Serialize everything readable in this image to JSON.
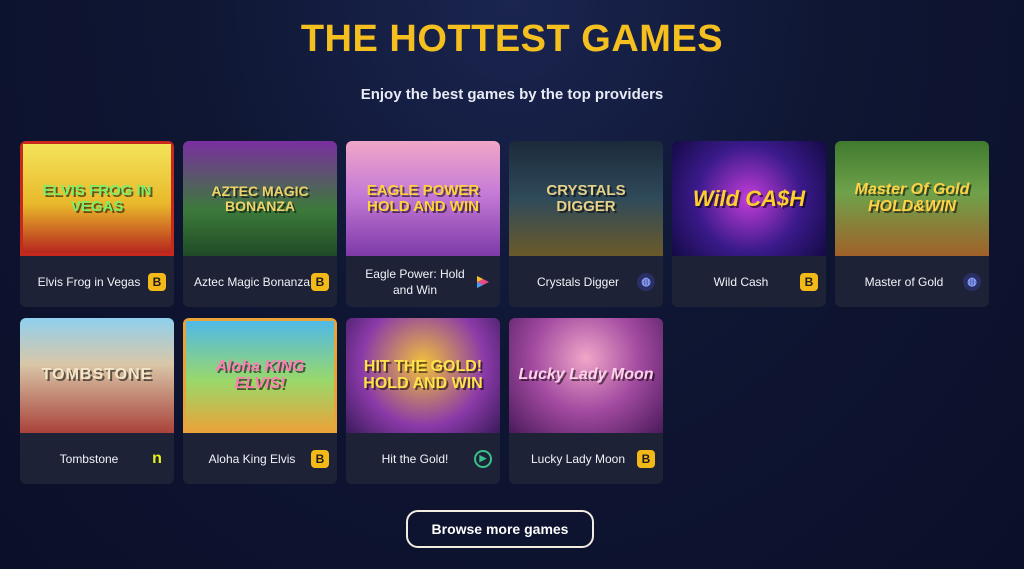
{
  "header": {
    "title": "THE HOTTEST GAMES",
    "subtitle": "Enjoy the best games by the top providers"
  },
  "games": [
    {
      "name": "Elvis Frog in Vegas",
      "art_text": "ELVIS FROG IN VEGAS",
      "provider_icon": "b-provider-icon"
    },
    {
      "name": "Aztec Magic Bonanza",
      "art_text": "AZTEC MAGIC BONANZA",
      "provider_icon": "b-provider-icon"
    },
    {
      "name": "Eagle Power: Hold and Win",
      "art_text": "EAGLE POWER HOLD AND WIN",
      "provider_icon": "triangle-provider-icon"
    },
    {
      "name": "Crystals Digger",
      "art_text": "CRYSTALS DIGGER",
      "provider_icon": "globe-provider-icon"
    },
    {
      "name": "Wild Cash",
      "art_text": "Wild CA$H",
      "provider_icon": "b-provider-icon"
    },
    {
      "name": "Master of Gold",
      "art_text": "Master Of Gold HOLD&WIN",
      "provider_icon": "globe-provider-icon"
    },
    {
      "name": "Tombstone",
      "art_text": "TOMBSTONE",
      "provider_icon": "n-provider-icon"
    },
    {
      "name": "Aloha King Elvis",
      "art_text": "Aloha KING ELVIS!",
      "provider_icon": "b-provider-icon"
    },
    {
      "name": "Hit the Gold!",
      "art_text": "HIT THE GOLD! HOLD AND WIN",
      "provider_icon": "ring-provider-icon"
    },
    {
      "name": "Lucky Lady Moon",
      "art_text": "Lucky Lady Moon",
      "provider_icon": "b-provider-icon"
    }
  ],
  "provider_glyphs": {
    "b": "B",
    "n": "n",
    "globe": "◍",
    "ring": "▶"
  },
  "browse_button": {
    "label": "Browse more games"
  },
  "colors": {
    "accent": "#f5bf1f",
    "background": "#0f1633",
    "card": "#1d2236"
  }
}
